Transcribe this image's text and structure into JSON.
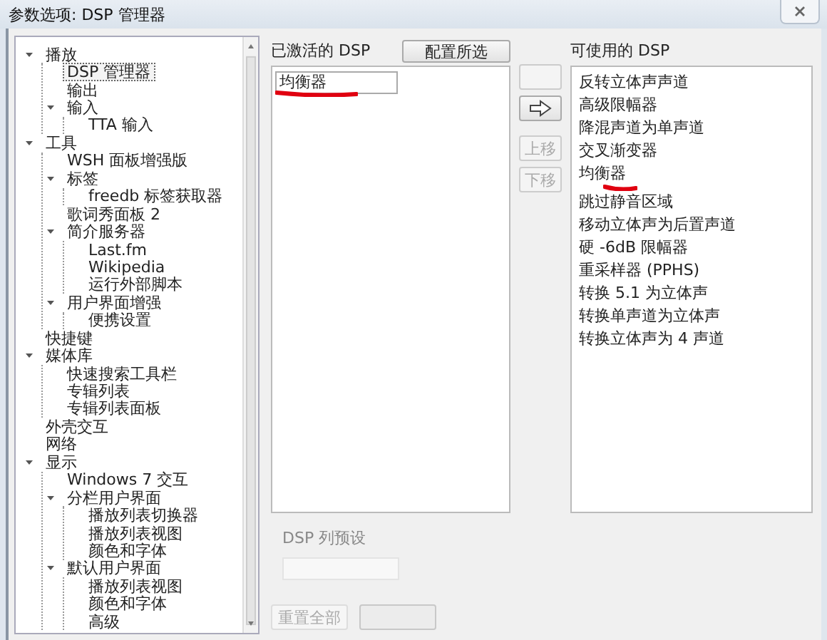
{
  "window": {
    "title": "参数选项: DSP 管理器"
  },
  "tree": [
    {
      "label": "播放",
      "selected": false,
      "expanded": true,
      "children": [
        {
          "label": "DSP 管理器",
          "selected": true
        },
        {
          "label": "输出",
          "selected": false
        },
        {
          "label": "输入",
          "selected": false,
          "expanded": true,
          "children": [
            {
              "label": "TTA 输入",
              "selected": false
            }
          ]
        }
      ]
    },
    {
      "label": "工具",
      "selected": false,
      "expanded": true,
      "children": [
        {
          "label": "WSH 面板增强版",
          "selected": false
        },
        {
          "label": "标签",
          "selected": false,
          "expanded": true,
          "children": [
            {
              "label": "freedb 标签获取器",
              "selected": false
            }
          ]
        },
        {
          "label": "歌词秀面板 2",
          "selected": false
        },
        {
          "label": "简介服务器",
          "selected": false,
          "expanded": true,
          "children": [
            {
              "label": "Last.fm",
              "selected": false
            },
            {
              "label": "Wikipedia",
              "selected": false
            },
            {
              "label": "运行外部脚本",
              "selected": false
            }
          ]
        },
        {
          "label": "用户界面增强",
          "selected": false,
          "expanded": true,
          "children": [
            {
              "label": "便携设置",
              "selected": false
            }
          ]
        }
      ]
    },
    {
      "label": "快捷键",
      "selected": false
    },
    {
      "label": "媒体库",
      "selected": false,
      "expanded": true,
      "children": [
        {
          "label": "快速搜索工具栏",
          "selected": false
        },
        {
          "label": "专辑列表",
          "selected": false
        },
        {
          "label": "专辑列表面板",
          "selected": false
        }
      ]
    },
    {
      "label": "外壳交互",
      "selected": false
    },
    {
      "label": "网络",
      "selected": false
    },
    {
      "label": "显示",
      "selected": false,
      "expanded": true,
      "children": [
        {
          "label": "Windows 7 交互",
          "selected": false
        },
        {
          "label": "分栏用户界面",
          "selected": false,
          "expanded": true,
          "children": [
            {
              "label": "播放列表切换器",
              "selected": false
            },
            {
              "label": "播放列表视图",
              "selected": false
            },
            {
              "label": "颜色和字体",
              "selected": false
            }
          ]
        },
        {
          "label": "默认用户界面",
          "selected": false,
          "expanded": true,
          "children": [
            {
              "label": "播放列表视图",
              "selected": false
            },
            {
              "label": "颜色和字体",
              "selected": false
            },
            {
              "label": "高级",
              "selected": false
            }
          ]
        }
      ]
    }
  ],
  "active_dsp": {
    "label": "已激活的 DSP",
    "configure_button": "配置所选",
    "items": [
      {
        "label": "均衡器",
        "selected": true
      }
    ]
  },
  "move_buttons": [
    {
      "kind": "blank",
      "disabled": true
    },
    {
      "kind": "arrow",
      "disabled": false
    },
    {
      "kind": "text",
      "label": "上移",
      "disabled": true
    },
    {
      "kind": "text",
      "label": "下移",
      "disabled": true
    }
  ],
  "available_dsp": {
    "label": "可使用的 DSP",
    "items": [
      {
        "label": "反转立体声声道",
        "selected": false
      },
      {
        "label": "高级限幅器",
        "selected": false
      },
      {
        "label": "降混声道为单声道",
        "selected": false
      },
      {
        "label": "交叉渐变器",
        "selected": false
      },
      {
        "label": "均衡器",
        "selected": false
      },
      {
        "label": "跳过静音区域",
        "selected": false
      },
      {
        "label": "移动立体声为后置声道",
        "selected": false
      },
      {
        "label": "硬 -6dB 限幅器",
        "selected": false
      },
      {
        "label": "重采样器 (PPHS)",
        "selected": false
      },
      {
        "label": "转换 5.1 为立体声",
        "selected": false
      },
      {
        "label": "转换单声道为立体声",
        "selected": false
      },
      {
        "label": "转换立体声为 4 声道",
        "selected": false
      }
    ]
  },
  "presets": {
    "label": "DSP 列预设"
  },
  "bottom_buttons": [
    {
      "label": "重置全部"
    }
  ]
}
